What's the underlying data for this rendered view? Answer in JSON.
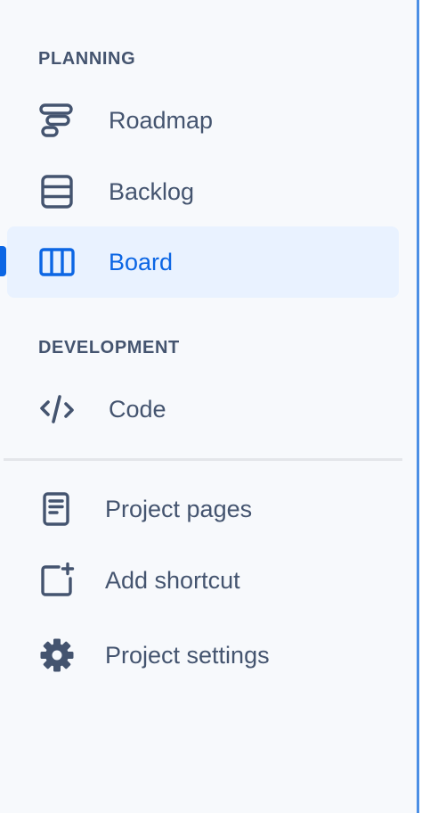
{
  "sidebar": {
    "planning": {
      "heading": "PLANNING",
      "items": [
        {
          "label": "Roadmap",
          "icon": "roadmap-icon",
          "selected": false
        },
        {
          "label": "Backlog",
          "icon": "backlog-icon",
          "selected": false
        },
        {
          "label": "Board",
          "icon": "board-icon",
          "selected": true
        }
      ]
    },
    "development": {
      "heading": "DEVELOPMENT",
      "items": [
        {
          "label": "Code",
          "icon": "code-icon",
          "selected": false
        }
      ]
    },
    "footer_items": [
      {
        "label": "Project pages",
        "icon": "page-icon"
      },
      {
        "label": "Add shortcut",
        "icon": "add-shortcut-icon"
      },
      {
        "label": "Project settings",
        "icon": "gear-icon"
      }
    ]
  },
  "colors": {
    "sidebar_background": "#f7f9fc",
    "text": "#44546f",
    "selected_text": "#0c66e4",
    "selected_background": "#e9f2ff",
    "selected_indicator": "#0c66e4",
    "resize_border": "#4c8fe5",
    "divider": "#e4e6ea"
  }
}
